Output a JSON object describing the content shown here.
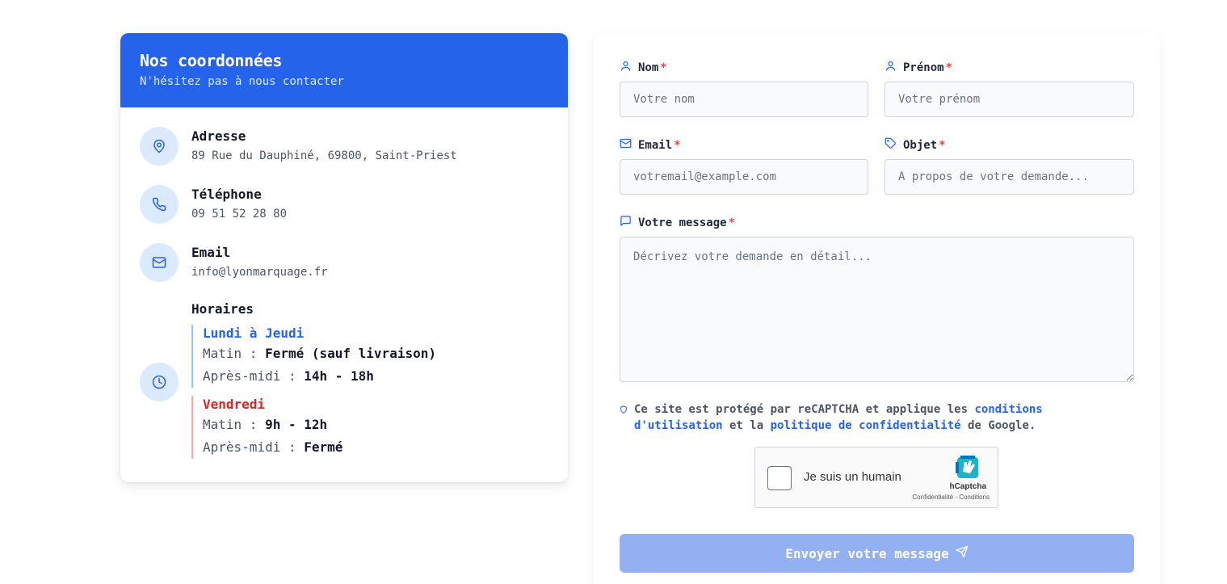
{
  "contact": {
    "title": "Nos coordonnées",
    "subtitle": "N'hésitez pas à nous contacter",
    "address": {
      "label": "Adresse",
      "value": "89 Rue du Dauphiné, 69800, Saint-Priest",
      "icon": "map-pin-icon"
    },
    "phone": {
      "label": "Téléphone",
      "value": "09 51 52 28 80",
      "icon": "phone-icon"
    },
    "email": {
      "label": "Email",
      "value": "info@lyonmarquage.fr",
      "icon": "mail-icon"
    },
    "hours": {
      "label": "Horaires",
      "icon": "clock-icon",
      "groups": [
        {
          "day": "Lundi à Jeudi",
          "morning_label": "Matin : ",
          "morning_value": "Fermé (sauf livraison)",
          "afternoon_label": "Après-midi : ",
          "afternoon_value": "14h - 18h"
        },
        {
          "day": "Vendredi",
          "morning_label": "Matin : ",
          "morning_value": "9h - 12h",
          "afternoon_label": "Après-midi : ",
          "afternoon_value": "Fermé"
        }
      ]
    }
  },
  "form": {
    "nom": {
      "label": "Nom",
      "placeholder": "Votre nom",
      "required": "*"
    },
    "prenom": {
      "label": "Prénom",
      "placeholder": "Votre prénom",
      "required": "*"
    },
    "email": {
      "label": "Email",
      "placeholder": "votremail@example.com",
      "required": "*"
    },
    "objet": {
      "label": "Objet",
      "placeholder": "À propos de votre demande...",
      "required": "*"
    },
    "message": {
      "label": "Votre message",
      "placeholder": "Décrivez votre demande en détail...",
      "required": "*"
    },
    "recaptcha": {
      "text_before": "Ce site est protégé par reCAPTCHA et applique les ",
      "link_terms": "conditions d'utilisation",
      "text_middle": " et la ",
      "link_privacy": "politique de confidentialité",
      "text_after": " de Google."
    },
    "hcaptcha": {
      "label": "Je suis un humain",
      "brand": "hCaptcha",
      "links": "Confidentialité - Conditions"
    },
    "submit_label": "Envoyer votre message"
  },
  "colors": {
    "primary": "#2563eb",
    "accent_light": "#dbeafe",
    "danger": "#dc2626",
    "submit_disabled": "#93b1f2"
  }
}
